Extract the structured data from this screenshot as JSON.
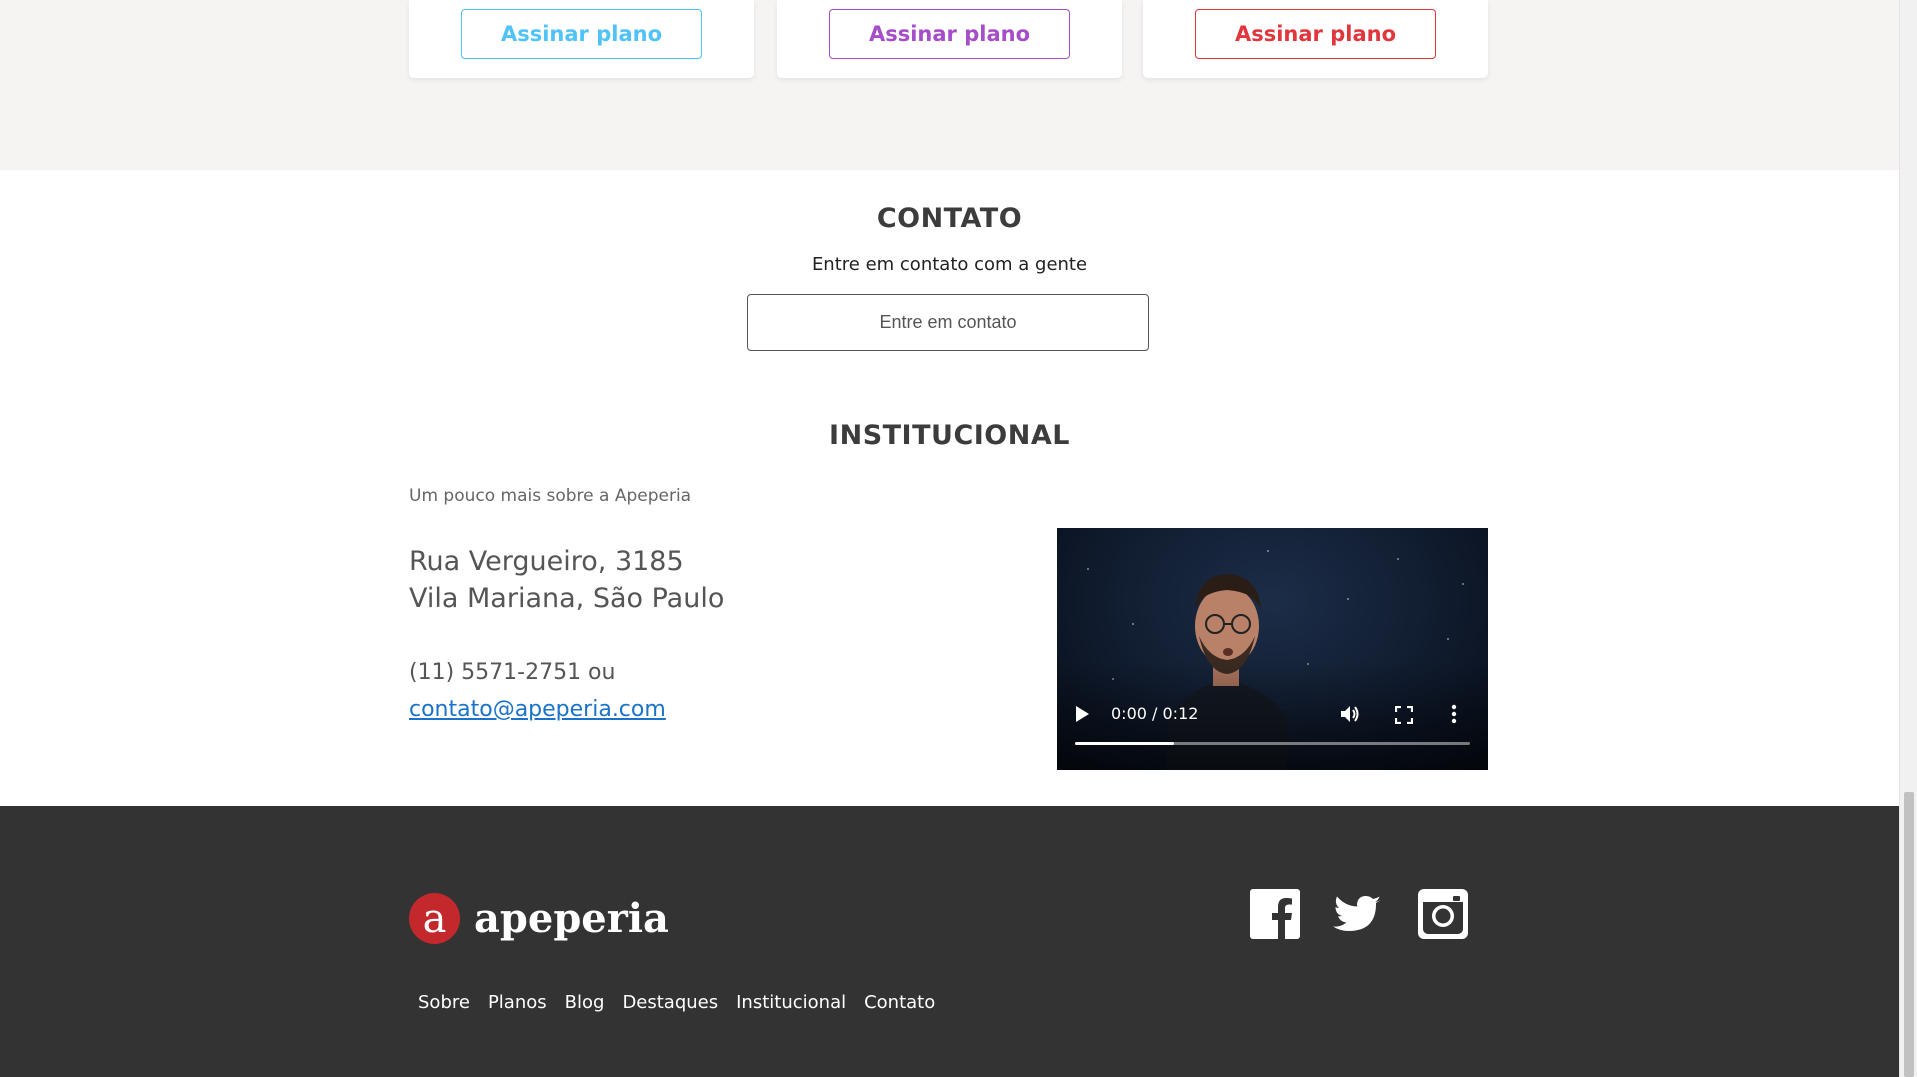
{
  "plans": {
    "cards": [
      {
        "button_label": "Assinar plano",
        "color": "#4fc3f7"
      },
      {
        "button_label": "Assinar plano",
        "color": "#a64dc9"
      },
      {
        "button_label": "Assinar plano",
        "color": "#e0363c"
      }
    ]
  },
  "contato": {
    "title": "CONTATO",
    "subtitle": "Entre em contato com a gente",
    "button_label": "Entre em contato"
  },
  "institucional": {
    "title": "INSTITUCIONAL",
    "subtitle": "Um pouco mais sobre a Apeperia",
    "address_line1": "Rua Vergueiro, 3185",
    "address_line2": "Vila Mariana, São Paulo",
    "phone": "(11) 5571-2751 ou",
    "email": "contato@apeperia.com",
    "video": {
      "time": "0:00 / 0:12",
      "progress_fraction": 0.25,
      "icons": [
        "play-icon",
        "volume-icon",
        "fullscreen-icon",
        "more-options-icon"
      ]
    }
  },
  "footer": {
    "logo_letter": "a",
    "logo_text": "apeperia",
    "logo_color": "#c3282d",
    "social": [
      "facebook-icon",
      "twitter-icon",
      "instagram-icon"
    ],
    "nav": [
      "Sobre",
      "Planos",
      "Blog",
      "Destaques",
      "Institucional",
      "Contato"
    ]
  }
}
